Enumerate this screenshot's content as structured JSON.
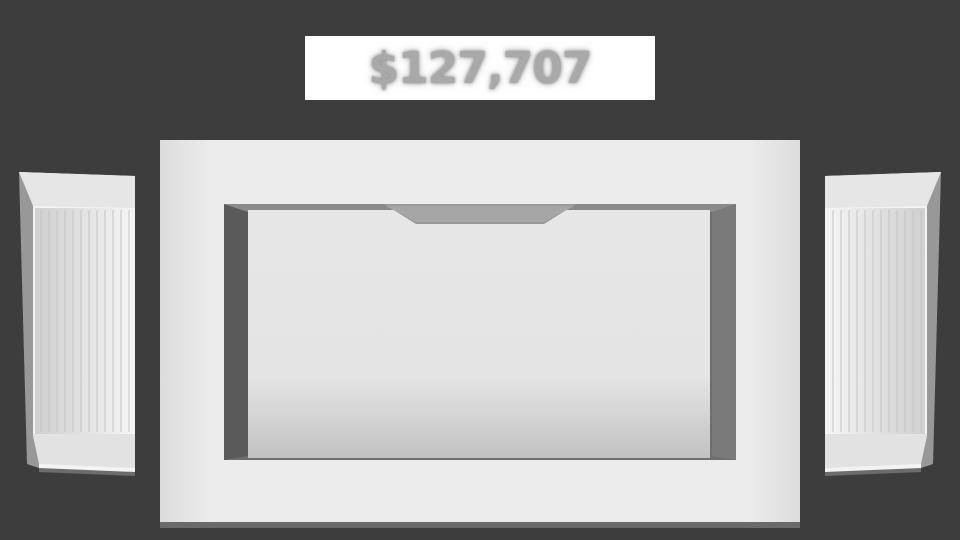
{
  "hud": {
    "score": "$127,707"
  },
  "colors": {
    "background": "#3d3d3d",
    "banner": "#ffffff",
    "score_text": "#a9a9a9",
    "frame": "#e9e9e9",
    "frame_inner_shadow": "#6e6e6e",
    "screen": "#e4e4e4",
    "panel_face": "#f2f2f2",
    "panel_groove": "#d0d0d0"
  },
  "icons": {
    "left_panel": "fluted-column-icon",
    "right_panel": "fluted-column-icon",
    "screen_notch": "notch-icon"
  }
}
